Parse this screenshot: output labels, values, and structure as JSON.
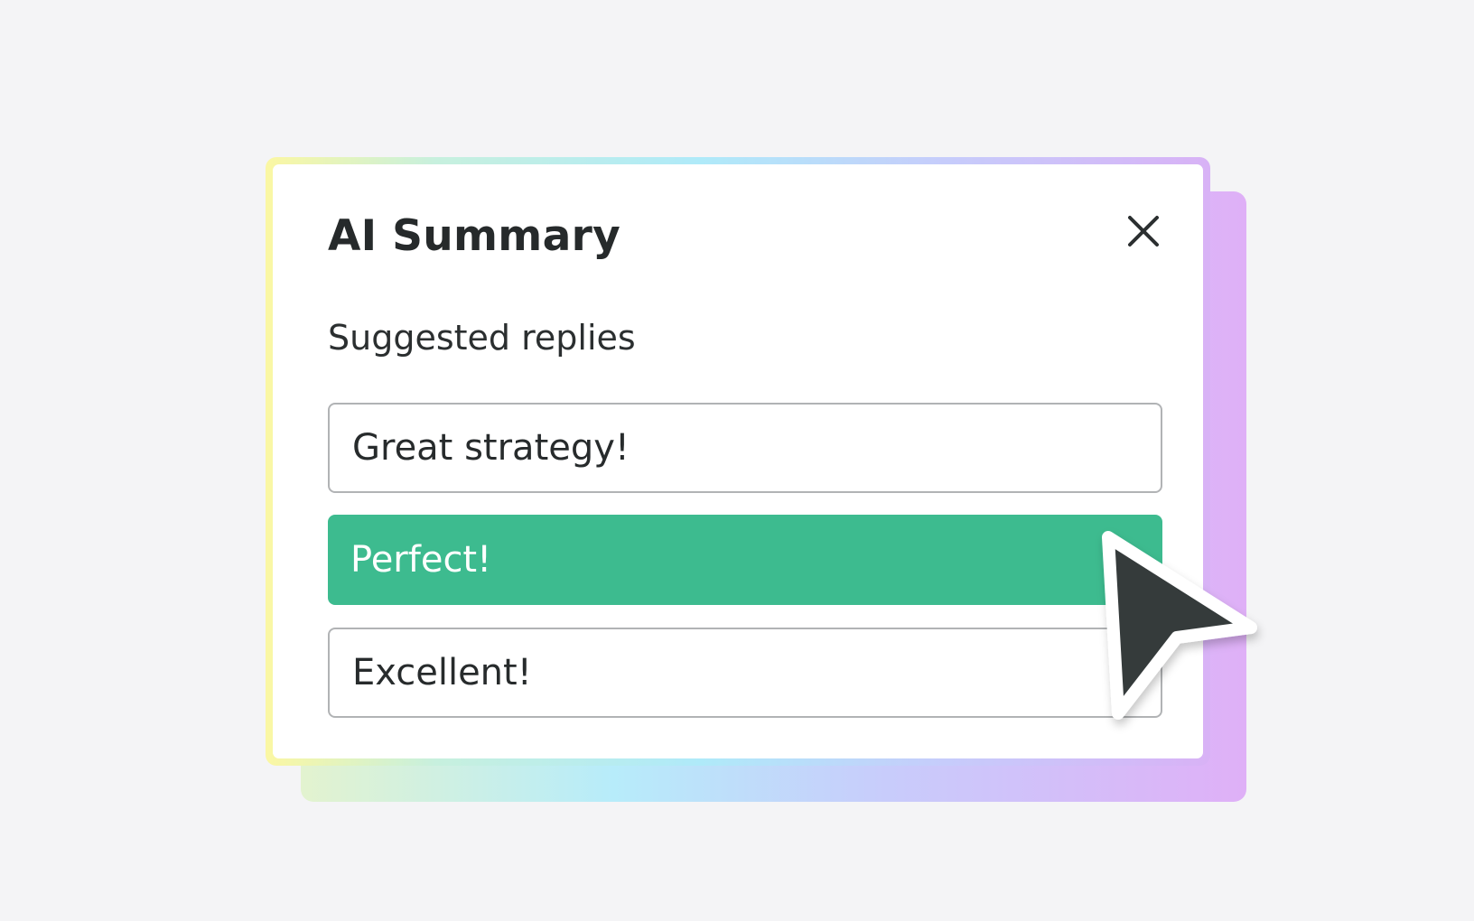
{
  "panel": {
    "title": "AI Summary",
    "close_icon": "close-icon",
    "subtitle": "Suggested replies",
    "replies": [
      {
        "label": "Great strategy!",
        "style": "outline"
      },
      {
        "label": "Perfect!",
        "style": "filled",
        "selected": true
      },
      {
        "label": "Excellent!",
        "style": "outline"
      }
    ]
  },
  "colors": {
    "background": "#f4f4f6",
    "selected_reply": "#3dbb8f",
    "text": "#262a2b",
    "cursor_fill": "#343a3b",
    "gradient_start": "#fbf7a3",
    "gradient_mid": "#afeaf9",
    "gradient_end": "#d8b2f6"
  },
  "cursor_icon": "mouse-pointer-icon"
}
